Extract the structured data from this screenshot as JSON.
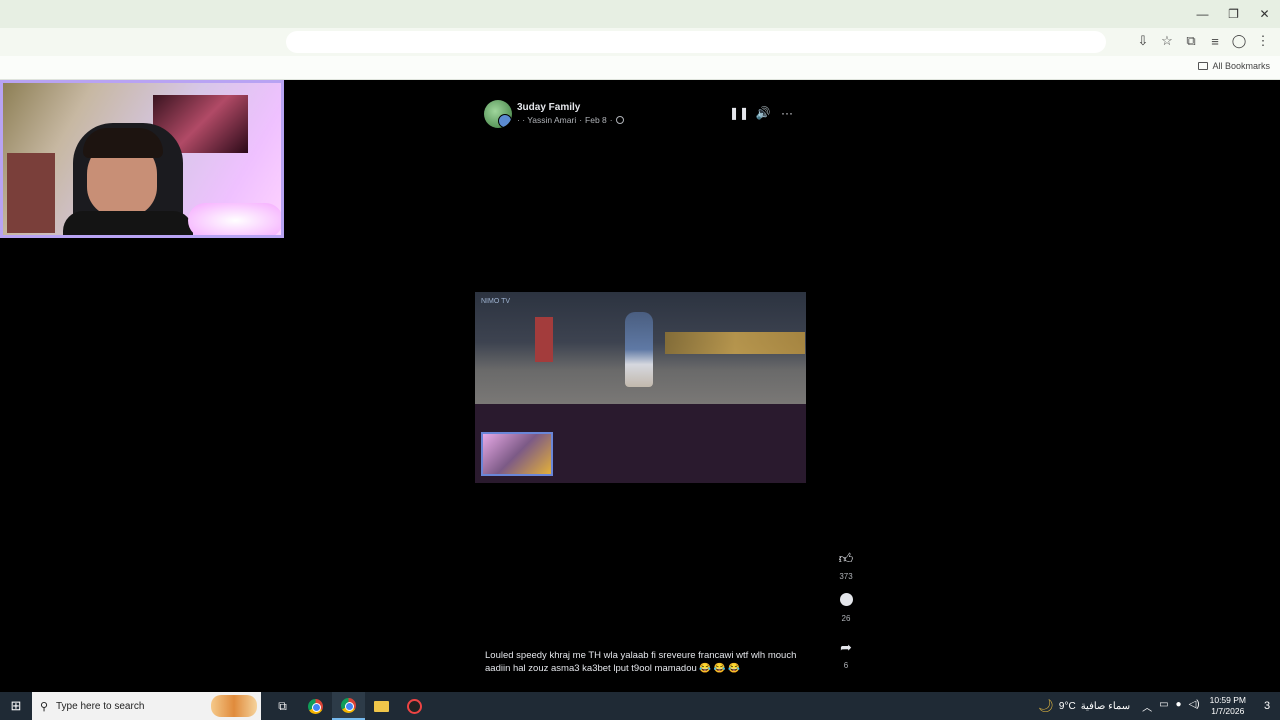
{
  "browser": {
    "window_controls": {
      "minimize": "—",
      "restore": "❐",
      "close": "✕"
    },
    "toolbar_icons": [
      "install-icon",
      "star-icon",
      "extensions-icon",
      "media-icon",
      "profile-icon",
      "menu-icon"
    ],
    "all_bookmarks_label": "All Bookmarks"
  },
  "post": {
    "page_name": "3uday Family",
    "author": "· · Yassin Amari",
    "separator": "·",
    "date": "Feb 8",
    "date_separator": "·",
    "controls": {
      "pause": "❚❚",
      "volume": "🔊",
      "more": "···"
    },
    "video_logo": "NIMO TV",
    "likes": "373",
    "comments": "26",
    "shares": "6",
    "caption": "Louled speedy khraj me TH wla yalaab fi sreveure francawi wtf wlh mouch aadiin hal zouz asma3 ka3bet lput t9ool mamadou 😂 😂 😂"
  },
  "taskbar": {
    "search_placeholder": "Type here to search",
    "weather_temp": "9°C",
    "weather_text": "سماء صافية",
    "time": "10:59 PM",
    "date": "1/7/2026",
    "notification_count": "3",
    "accent_color": "#76b9ed"
  }
}
